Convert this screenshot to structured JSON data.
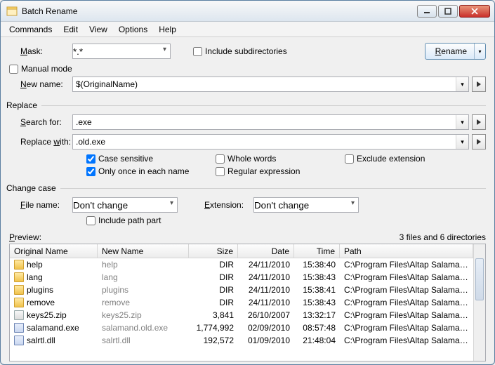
{
  "window": {
    "title": "Batch Rename"
  },
  "menubar": {
    "commands": "Commands",
    "edit": "Edit",
    "view": "View",
    "options": "Options",
    "help": "Help"
  },
  "mask": {
    "label": "Mask:",
    "value": "*.*",
    "include_subdirs_label": "Include subdirectories"
  },
  "rename_button": "Rename",
  "manual_mode_label": "Manual mode",
  "newname": {
    "label": "New name:",
    "value": "$(OriginalName)"
  },
  "sections": {
    "replace": "Replace",
    "change_case": "Change case"
  },
  "replace": {
    "search_label": "Search for:",
    "search_value": ".exe",
    "replace_label": "Replace with:",
    "replace_value": ".old.exe",
    "cb_case_sensitive": "Case sensitive",
    "cb_whole_words": "Whole words",
    "cb_exclude_ext": "Exclude extension",
    "cb_only_once": "Only once in each name",
    "cb_regex": "Regular expression"
  },
  "changecase": {
    "filename_label": "File name:",
    "filename_value": "Don't change",
    "extension_label": "Extension:",
    "extension_value": "Don't change",
    "cb_include_path": "Include path part"
  },
  "preview": {
    "label": "Preview:",
    "summary": "3 files and 6 directories",
    "headers": {
      "original": "Original Name",
      "new": "New Name",
      "size": "Size",
      "date": "Date",
      "time": "Time",
      "path": "Path"
    },
    "rows": [
      {
        "icon": "folder",
        "orig": "help",
        "new": "help",
        "size": "DIR",
        "date": "24/11/2010",
        "time": "15:38:40",
        "path": "C:\\Program Files\\Altap Salamander"
      },
      {
        "icon": "folder",
        "orig": "lang",
        "new": "lang",
        "size": "DIR",
        "date": "24/11/2010",
        "time": "15:38:43",
        "path": "C:\\Program Files\\Altap Salamander"
      },
      {
        "icon": "folder",
        "orig": "plugins",
        "new": "plugins",
        "size": "DIR",
        "date": "24/11/2010",
        "time": "15:38:41",
        "path": "C:\\Program Files\\Altap Salamander"
      },
      {
        "icon": "folder",
        "orig": "remove",
        "new": "remove",
        "size": "DIR",
        "date": "24/11/2010",
        "time": "15:38:43",
        "path": "C:\\Program Files\\Altap Salamander"
      },
      {
        "icon": "zip",
        "orig": "keys25.zip",
        "new": "keys25.zip",
        "size": "3,841",
        "date": "26/10/2007",
        "time": "13:32:17",
        "path": "C:\\Program Files\\Altap Salamander"
      },
      {
        "icon": "exe",
        "orig": "salamand.exe",
        "new": "salamand.old.exe",
        "size": "1,774,992",
        "date": "02/09/2010",
        "time": "08:57:48",
        "path": "C:\\Program Files\\Altap Salamander"
      },
      {
        "icon": "exe",
        "orig": "salrtl.dll",
        "new": "salrtl.dll",
        "size": "192,572",
        "date": "01/09/2010",
        "time": "21:48:04",
        "path": "C:\\Program Files\\Altap Salamander"
      }
    ]
  }
}
